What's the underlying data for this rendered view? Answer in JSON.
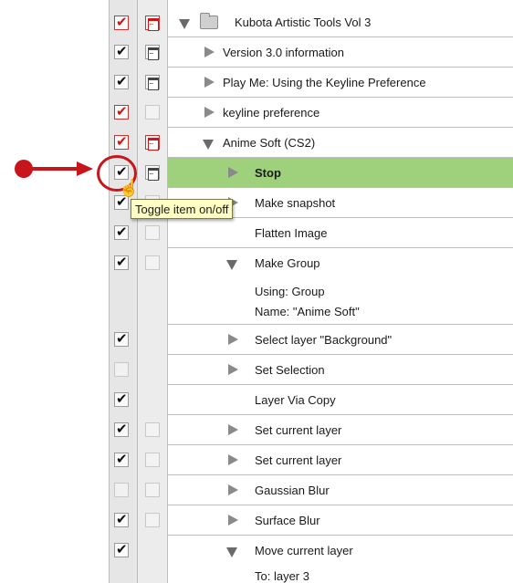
{
  "set": {
    "title": "Kubota Artistic Tools Vol 3"
  },
  "actions": [
    {
      "label": "Version 3.0 information"
    },
    {
      "label": "Play Me: Using the Keyline Preference"
    },
    {
      "label": "keyline preference"
    },
    {
      "label": "Anime Soft (CS2)"
    }
  ],
  "steps": [
    {
      "label": "Stop"
    },
    {
      "label": "Make snapshot"
    },
    {
      "label": "Flatten Image"
    },
    {
      "label": "Make Group",
      "details": [
        "Using: Group",
        "Name:  \"Anime Soft\""
      ]
    },
    {
      "label": "Select layer \"Background\""
    },
    {
      "label": "Set Selection"
    },
    {
      "label": "Layer Via Copy"
    },
    {
      "label": "Set current layer"
    },
    {
      "label": "Set current layer"
    },
    {
      "label": "Gaussian Blur"
    },
    {
      "label": "Surface Blur"
    },
    {
      "label": "Move current layer",
      "details": [
        "To: layer 3"
      ]
    }
  ],
  "tooltip": {
    "text": "Toggle item on/off"
  },
  "colors": {
    "highlight": "#9fd07c",
    "annotation": "#c8151b",
    "checkmark_red": "#d21414"
  }
}
